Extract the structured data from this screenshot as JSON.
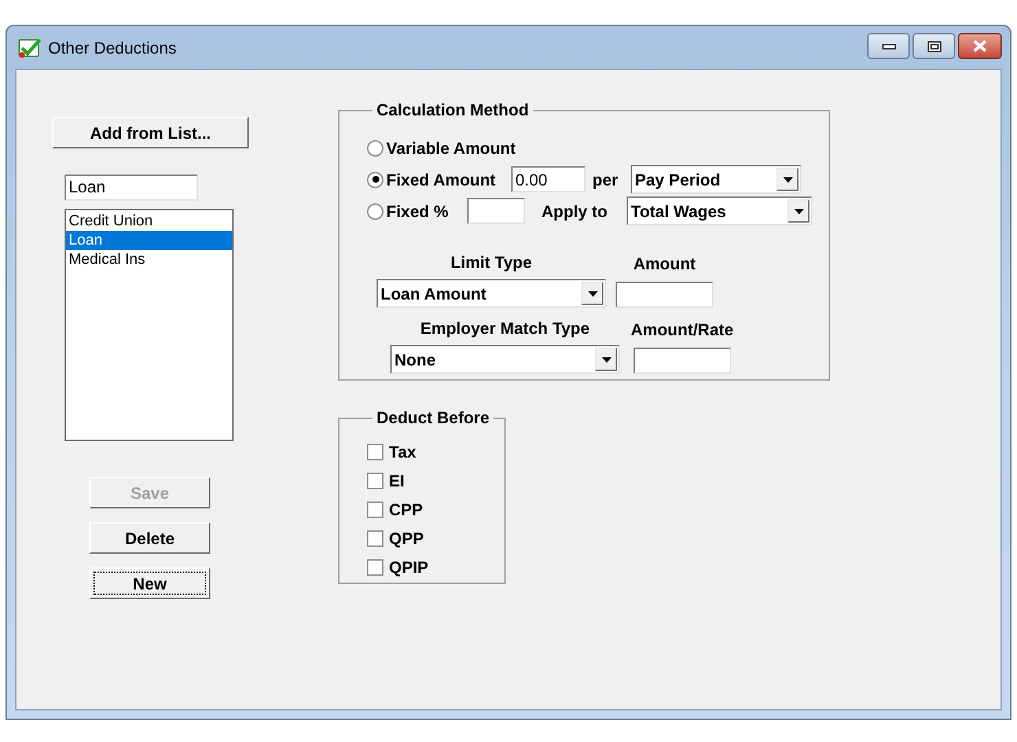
{
  "window": {
    "title": "Other Deductions"
  },
  "add_button": {
    "label": "Add from List..."
  },
  "name_field": {
    "value": "Loan"
  },
  "deductions": [
    {
      "label": "Credit Union",
      "selected": false
    },
    {
      "label": "Loan",
      "selected": true
    },
    {
      "label": "Medical Ins",
      "selected": false
    }
  ],
  "buttons": [
    {
      "label": "Save",
      "disabled": true,
      "focused": false
    },
    {
      "label": "Delete",
      "disabled": false,
      "focused": false
    },
    {
      "label": "New",
      "disabled": false,
      "focused": true
    }
  ],
  "calculation_method": {
    "title": "Calculation Method",
    "options": [
      {
        "kind": "plain",
        "label": "Variable Amount",
        "selected": false
      },
      {
        "kind": "amount",
        "label": "Fixed Amount",
        "selected": true,
        "field": {
          "value": "0.00"
        },
        "connector": "per",
        "dropdown": {
          "value": "Pay Period"
        }
      },
      {
        "kind": "percent",
        "label": "Fixed %",
        "selected": false,
        "connector": "Apply to",
        "dropdown": {
          "value": "Total Wages"
        }
      }
    ],
    "limit": {
      "label": "Limit Type",
      "dropdown": {
        "value": "Loan Amount"
      },
      "amount_label": "Amount"
    },
    "match": {
      "label": "Employer Match Type",
      "dropdown": {
        "value": "None"
      },
      "amount_label": "Amount/Rate"
    }
  },
  "deduct_before": {
    "title": "Deduct Before",
    "items": [
      {
        "label": "Tax",
        "checked": false
      },
      {
        "label": "EI",
        "checked": false
      },
      {
        "label": "CPP",
        "checked": false
      },
      {
        "label": "QPP",
        "checked": false
      },
      {
        "label": "QPIP",
        "checked": false
      }
    ]
  }
}
